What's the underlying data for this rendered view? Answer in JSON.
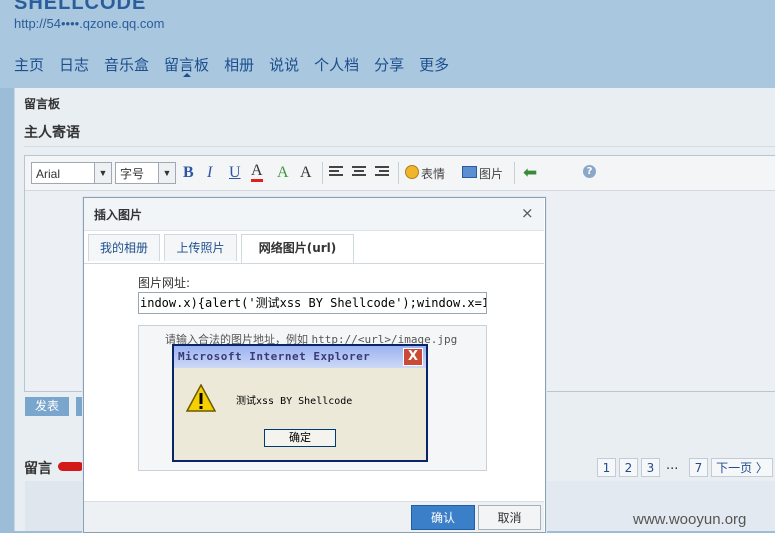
{
  "header": {
    "site_title": "SHELLCODE",
    "site_url": "http://54••••.qzone.qq.com"
  },
  "nav": {
    "items": [
      "主页",
      "日志",
      "音乐盒",
      "留言板",
      "相册",
      "说说",
      "个人档",
      "分享",
      "更多"
    ],
    "active_index": 3
  },
  "board": {
    "label": "留言板",
    "host_title": "主人寄语"
  },
  "toolbar": {
    "font_value": "Arial",
    "size_value": "字号",
    "bold": "B",
    "italic": "I",
    "underline": "U",
    "font_color": "A",
    "font_effect": "A",
    "highlight": "A",
    "emoticon_label": "表情",
    "image_label": "图片",
    "help": "?"
  },
  "publish_label": "发表",
  "messages": {
    "title": "留言"
  },
  "pagination": {
    "pages": [
      "1",
      "2",
      "3"
    ],
    "ellipsis": "...",
    "last": "7",
    "next": "下一页 〉"
  },
  "watermark": "www.wooyun.org",
  "dialog": {
    "title": "插入图片",
    "close": "×",
    "tabs": [
      "我的相册",
      "上传照片",
      "网络图片(url)"
    ],
    "active_tab": 2,
    "url_label": "图片网址:",
    "url_value": "indow.x){alert('测试xss BY Shellcode');window.x=1;",
    "hint": "请输入合法的图片地址，例如",
    "hint_example": "http://<url>/image.jpg",
    "ok": "确认",
    "cancel": "取消"
  },
  "alert": {
    "title": "Microsoft Internet Explorer",
    "close": "X",
    "message": "测试xss BY Shellcode",
    "ok": "确定"
  },
  "colors": {
    "accent": "#1d4f8e",
    "primary_button": "#3b7fc9",
    "xp_title": "#9ab2f0",
    "alert_bg": "#ece9d8"
  }
}
